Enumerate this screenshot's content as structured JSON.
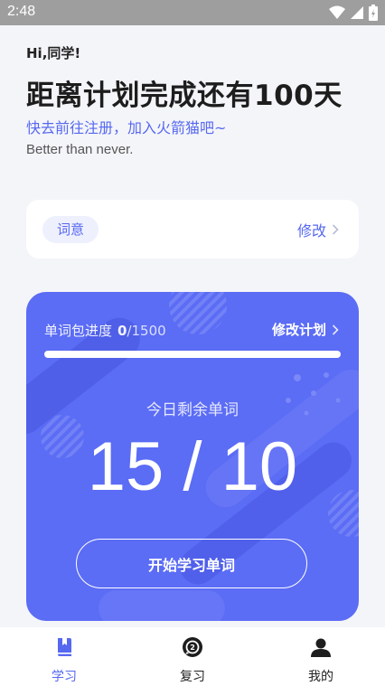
{
  "status_bar": {
    "time": "2:48"
  },
  "header": {
    "greeting": "Hi,同学!",
    "headline": "距离计划完成还有100天",
    "register_prompt": "快去前往注册，加入火箭猫吧~",
    "motto": "Better than never."
  },
  "study_mode": {
    "chip_label": "词意",
    "edit_label": "修改"
  },
  "plan": {
    "progress_label": "单词包进度",
    "progress_current": "0",
    "progress_total": "/1500",
    "progress_fraction": 0,
    "edit_label": "修改计划",
    "remaining_label": "今日剩余单词",
    "counts": "15 / 10",
    "start_button": "开始学习单词"
  },
  "tabs": [
    {
      "label": "学习",
      "icon": "book-icon",
      "active": true
    },
    {
      "label": "复习",
      "icon": "review-icon",
      "active": false
    },
    {
      "label": "我的",
      "icon": "user-icon",
      "active": false
    }
  ],
  "colors": {
    "accent": "#5668f0",
    "card": "#5b6cf5",
    "background": "#f4f5f9"
  }
}
